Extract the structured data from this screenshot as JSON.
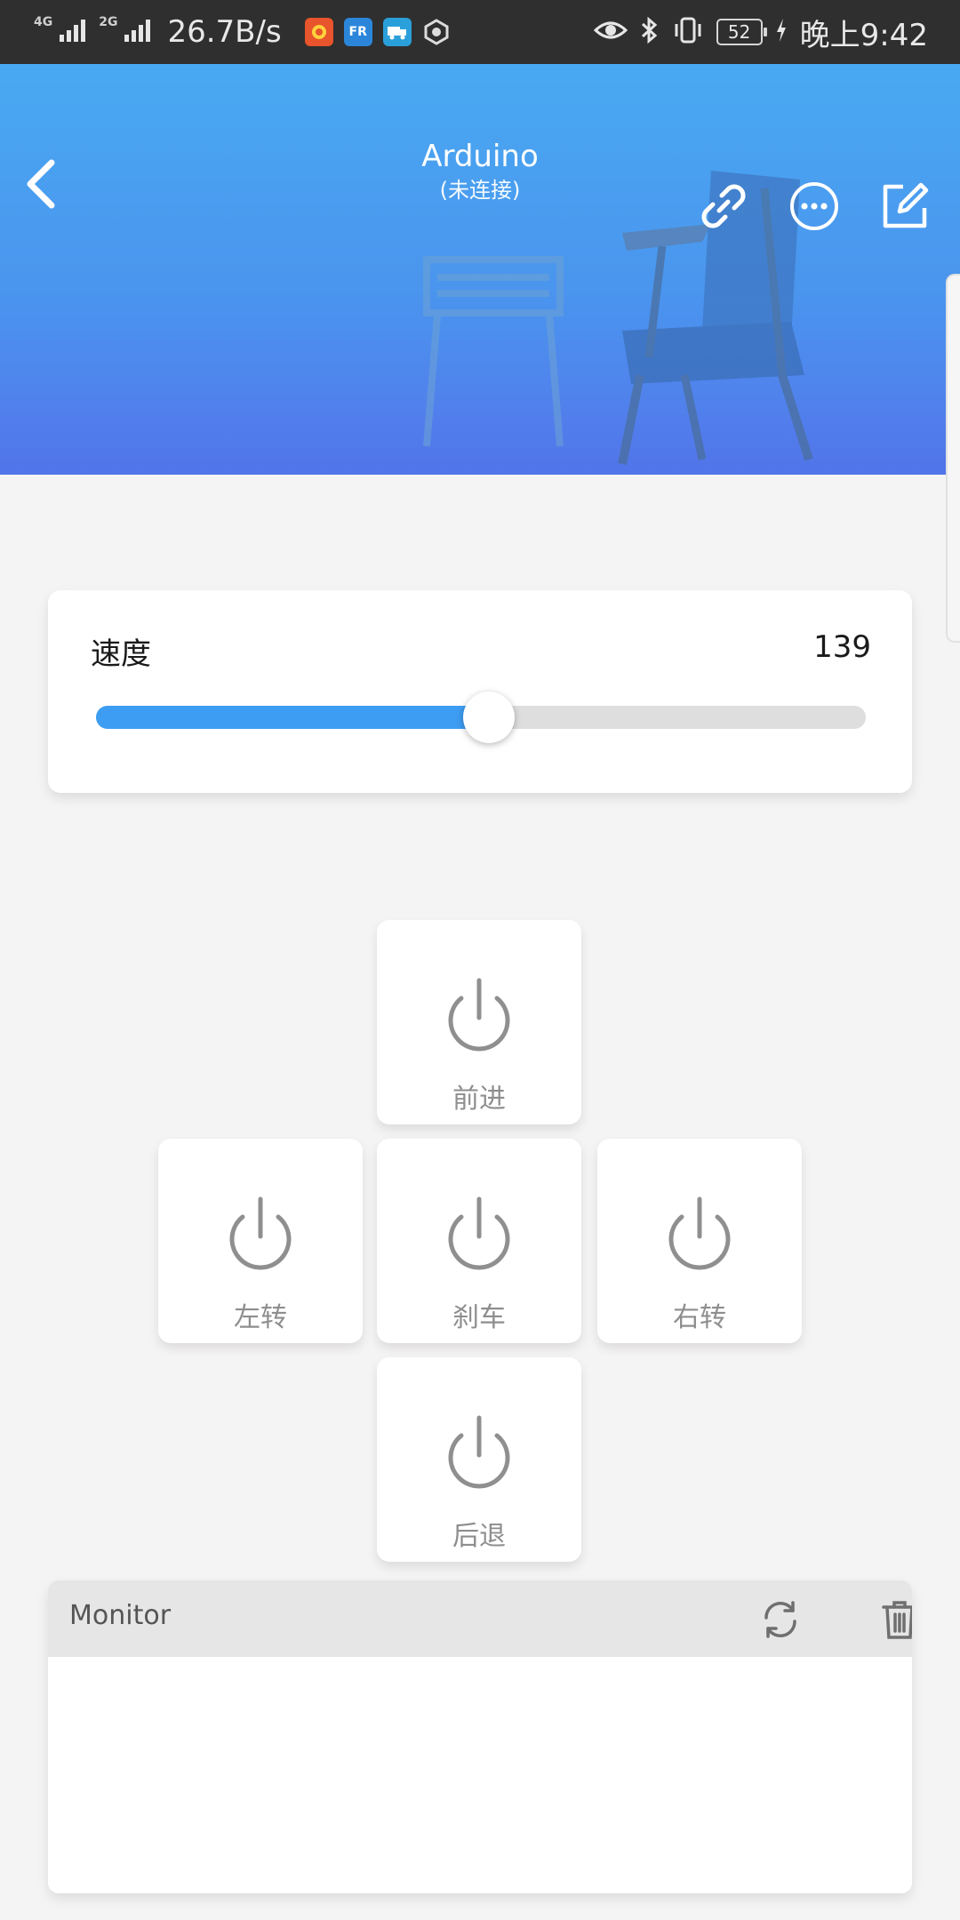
{
  "status_bar": {
    "network_1": "4G",
    "network_2": "2G",
    "net_speed": "26.7B/s",
    "app_icons": [
      {
        "name": "orange-app-icon",
        "color": "#e8542b"
      },
      {
        "name": "fr-app-icon",
        "text": "FR",
        "color": "#2b86d9"
      },
      {
        "name": "truck-app-icon",
        "color": "#2aa0db"
      },
      {
        "name": "hand-app-icon",
        "color": "#6d6d6d"
      }
    ],
    "battery": "52",
    "time": "晚上9:42"
  },
  "header": {
    "title": "Arduino",
    "subtitle": "(未连接)",
    "colors": {
      "top": "#49a9f2",
      "bottom": "#5278ec"
    }
  },
  "speed": {
    "label": "速度",
    "value": "139",
    "level": 0.51,
    "accent": "#3d9df2"
  },
  "controls": {
    "forward": "前进",
    "left": "左转",
    "brake": "刹车",
    "right": "右转",
    "back": "后退"
  },
  "monitor": {
    "title": "Monitor"
  }
}
